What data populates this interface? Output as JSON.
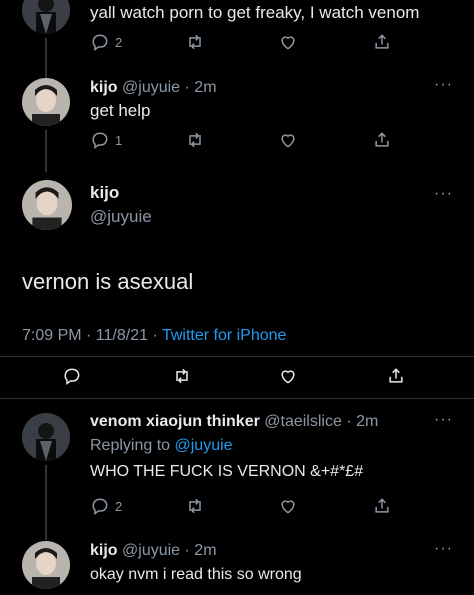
{
  "tweets": [
    {
      "text": "yall watch porn to get freaky, I watch venom",
      "reply_count": "2"
    },
    {
      "name": "kijo",
      "handle": "@juyuie",
      "time": "· 2m",
      "text": "get help",
      "reply_count": "1",
      "more": "···"
    }
  ],
  "main_tweet": {
    "name": "kijo",
    "handle": "@juyuie",
    "text": "vernon is asexual",
    "timestamp": "7:09 PM · 11/8/21 · ",
    "source": "Twitter for iPhone",
    "more": "···"
  },
  "replies": [
    {
      "name": "venom xiaojun thinker",
      "handle": "@taeilslice",
      "time": "· 2m",
      "replying_prefix": "Replying to ",
      "replying_handle": "@juyuie",
      "text": "WHO THE FUCK IS VERNON &+#*£#",
      "reply_count": "2",
      "more": "···"
    },
    {
      "name": "kijo",
      "handle": "@juyuie",
      "time": "· 2m",
      "text": "okay nvm i read this so wrong",
      "more": "···"
    }
  ],
  "icons": {
    "reply": "reply-icon",
    "retweet": "retweet-icon",
    "like": "like-icon",
    "share": "share-icon"
  },
  "colors": {
    "background": "#000000",
    "text": "#e7e9ea",
    "secondary": "#8b98a5",
    "link": "#1d9bf0",
    "divider": "#2f3336"
  }
}
